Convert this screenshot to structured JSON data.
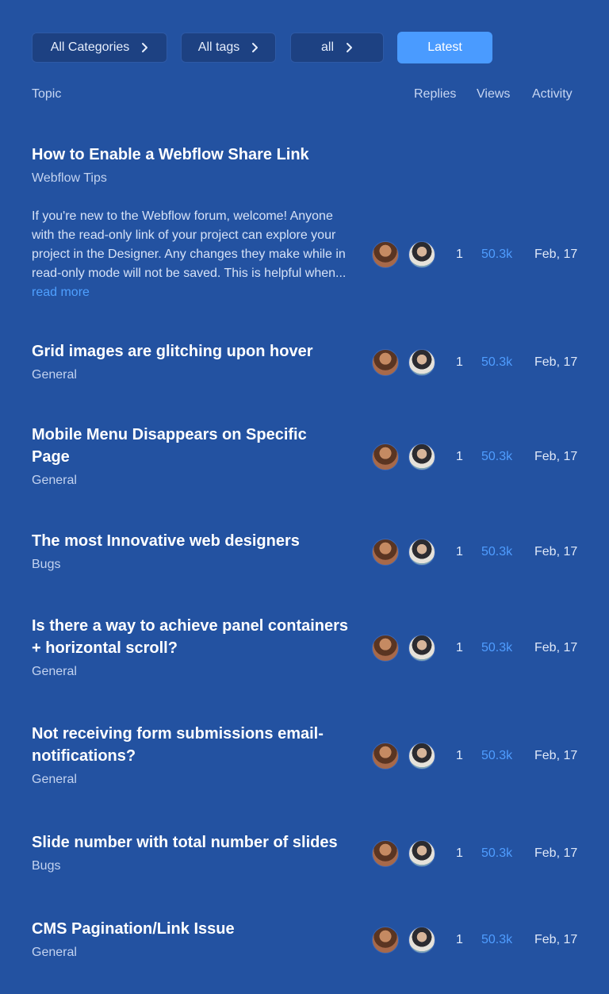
{
  "filters": {
    "categories": "All Categories",
    "tags": "All tags",
    "all": "all",
    "latest": "Latest"
  },
  "columns": {
    "topic": "Topic",
    "replies": "Replies",
    "views": "Views",
    "activity": "Activity"
  },
  "colors": {
    "background": "#2352a1",
    "chip": "#1d4182",
    "accent": "#4a9bff"
  },
  "topics": [
    {
      "title": "How to Enable a Webflow Share Link",
      "category": "Webflow Tips",
      "excerpt": "If you're new to the Webflow forum, welcome! Anyone with the read-only link of your project can explore your project in the Designer. Any changes they make while in read-only mode will not be saved. This is helpful when...",
      "read_more": "read more",
      "replies": "1",
      "views": "50.3k",
      "activity": "Feb, 17"
    },
    {
      "title": "Grid images are glitching upon hover",
      "category": "General",
      "replies": "1",
      "views": "50.3k",
      "activity": "Feb, 17"
    },
    {
      "title": "Mobile Menu Disappears on Specific Page",
      "category": "General",
      "replies": "1",
      "views": "50.3k",
      "activity": "Feb, 17"
    },
    {
      "title": "The most Innovative web designers",
      "category": "Bugs",
      "replies": "1",
      "views": "50.3k",
      "activity": "Feb, 17"
    },
    {
      "title": "Is there a way to achieve panel containers + horizontal scroll?",
      "category": "General",
      "replies": "1",
      "views": "50.3k",
      "activity": "Feb, 17"
    },
    {
      "title": "Not receiving form submissions email-notifications?",
      "category": "General",
      "replies": "1",
      "views": "50.3k",
      "activity": "Feb, 17"
    },
    {
      "title": "Slide number with total number of slides",
      "category": "Bugs",
      "replies": "1",
      "views": "50.3k",
      "activity": "Feb, 17"
    },
    {
      "title": "CMS Pagination/Link Issue",
      "category": "General",
      "replies": "1",
      "views": "50.3k",
      "activity": "Feb, 17"
    }
  ]
}
